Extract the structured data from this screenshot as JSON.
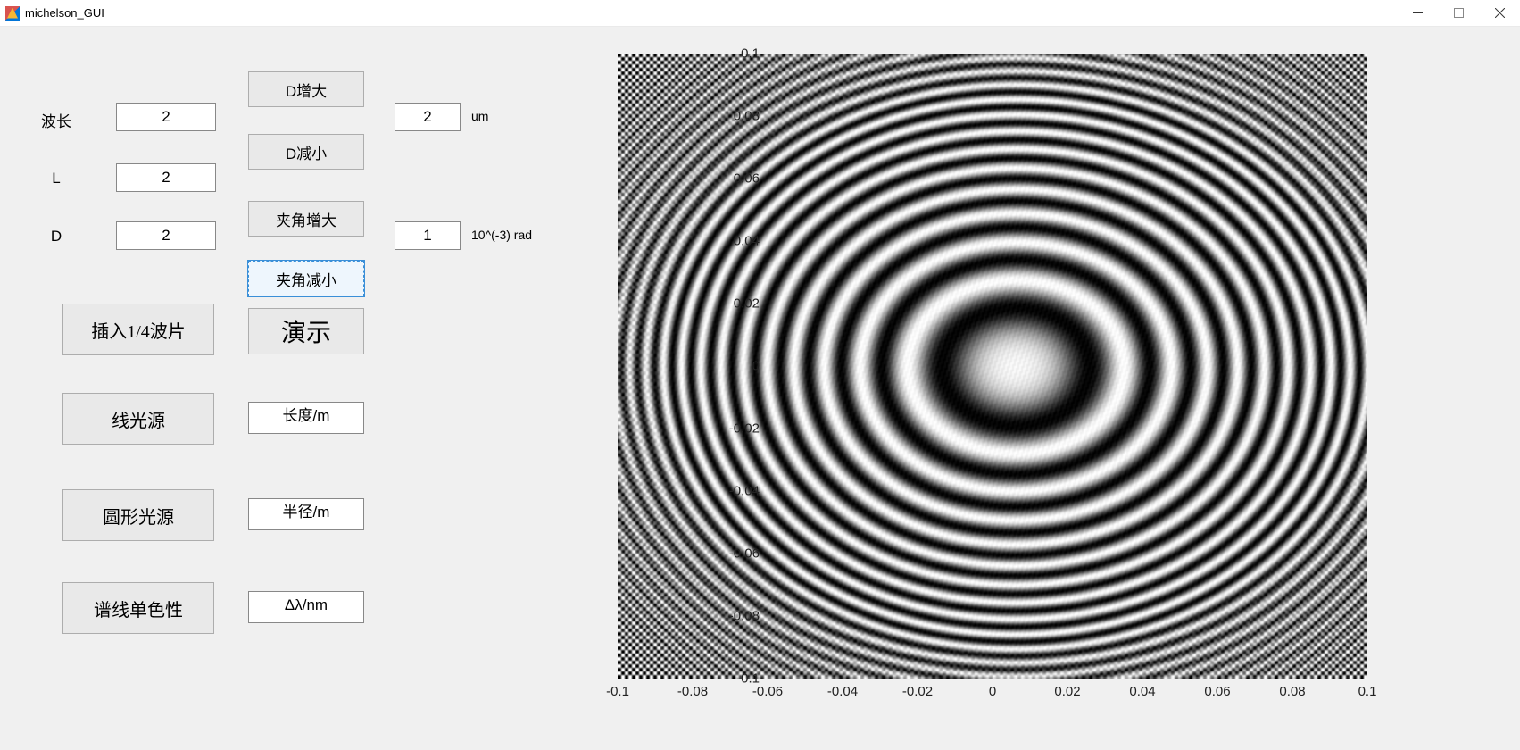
{
  "window": {
    "title": "michelson_GUI"
  },
  "labels": {
    "wavelength": "波长",
    "L": "L",
    "D": "D",
    "um": "um",
    "rad": "10^(-3) rad"
  },
  "inputs": {
    "wavelength": "2",
    "L": "2",
    "D": "2",
    "D_step": "2",
    "angle_step": "1",
    "line_length": "长度/m",
    "circle_radius": "半径/m",
    "delta_lambda": "Δλ/nm"
  },
  "buttons": {
    "D_inc": "D增大",
    "D_dec": "D减小",
    "angle_inc": "夹角增大",
    "angle_dec": "夹角减小",
    "demo": "演示",
    "quarter_wave": "插入1/4波片",
    "line_source": "线光源",
    "circle_source": "圆形光源",
    "monochrome": "谱线单色性"
  },
  "axes": {
    "y_ticks": [
      "0.1",
      "0.08",
      "0.06",
      "0.04",
      "0.02",
      "0",
      "-0.02",
      "-0.04",
      "-0.06",
      "-0.08",
      "-0.1"
    ],
    "x_ticks": [
      "-0.1",
      "-0.08",
      "-0.06",
      "-0.04",
      "-0.02",
      "0",
      "0.02",
      "0.04",
      "0.06",
      "0.08",
      "0.1"
    ]
  },
  "chart_data": {
    "type": "heatmap",
    "title": "",
    "xlabel": "",
    "ylabel": "",
    "xlim": [
      -0.1,
      0.1
    ],
    "ylim": [
      -0.1,
      0.1
    ],
    "description": "Michelson interference fringes: concentric elliptical rings, grayscale intensity cos pattern, center slightly right-of-center, aspect slightly wider than tall; corners show high-frequency checker aliasing.",
    "params": {
      "wavelength_um": 2,
      "L": 2,
      "D_um": 2,
      "tilt_mrad": 1
    }
  }
}
